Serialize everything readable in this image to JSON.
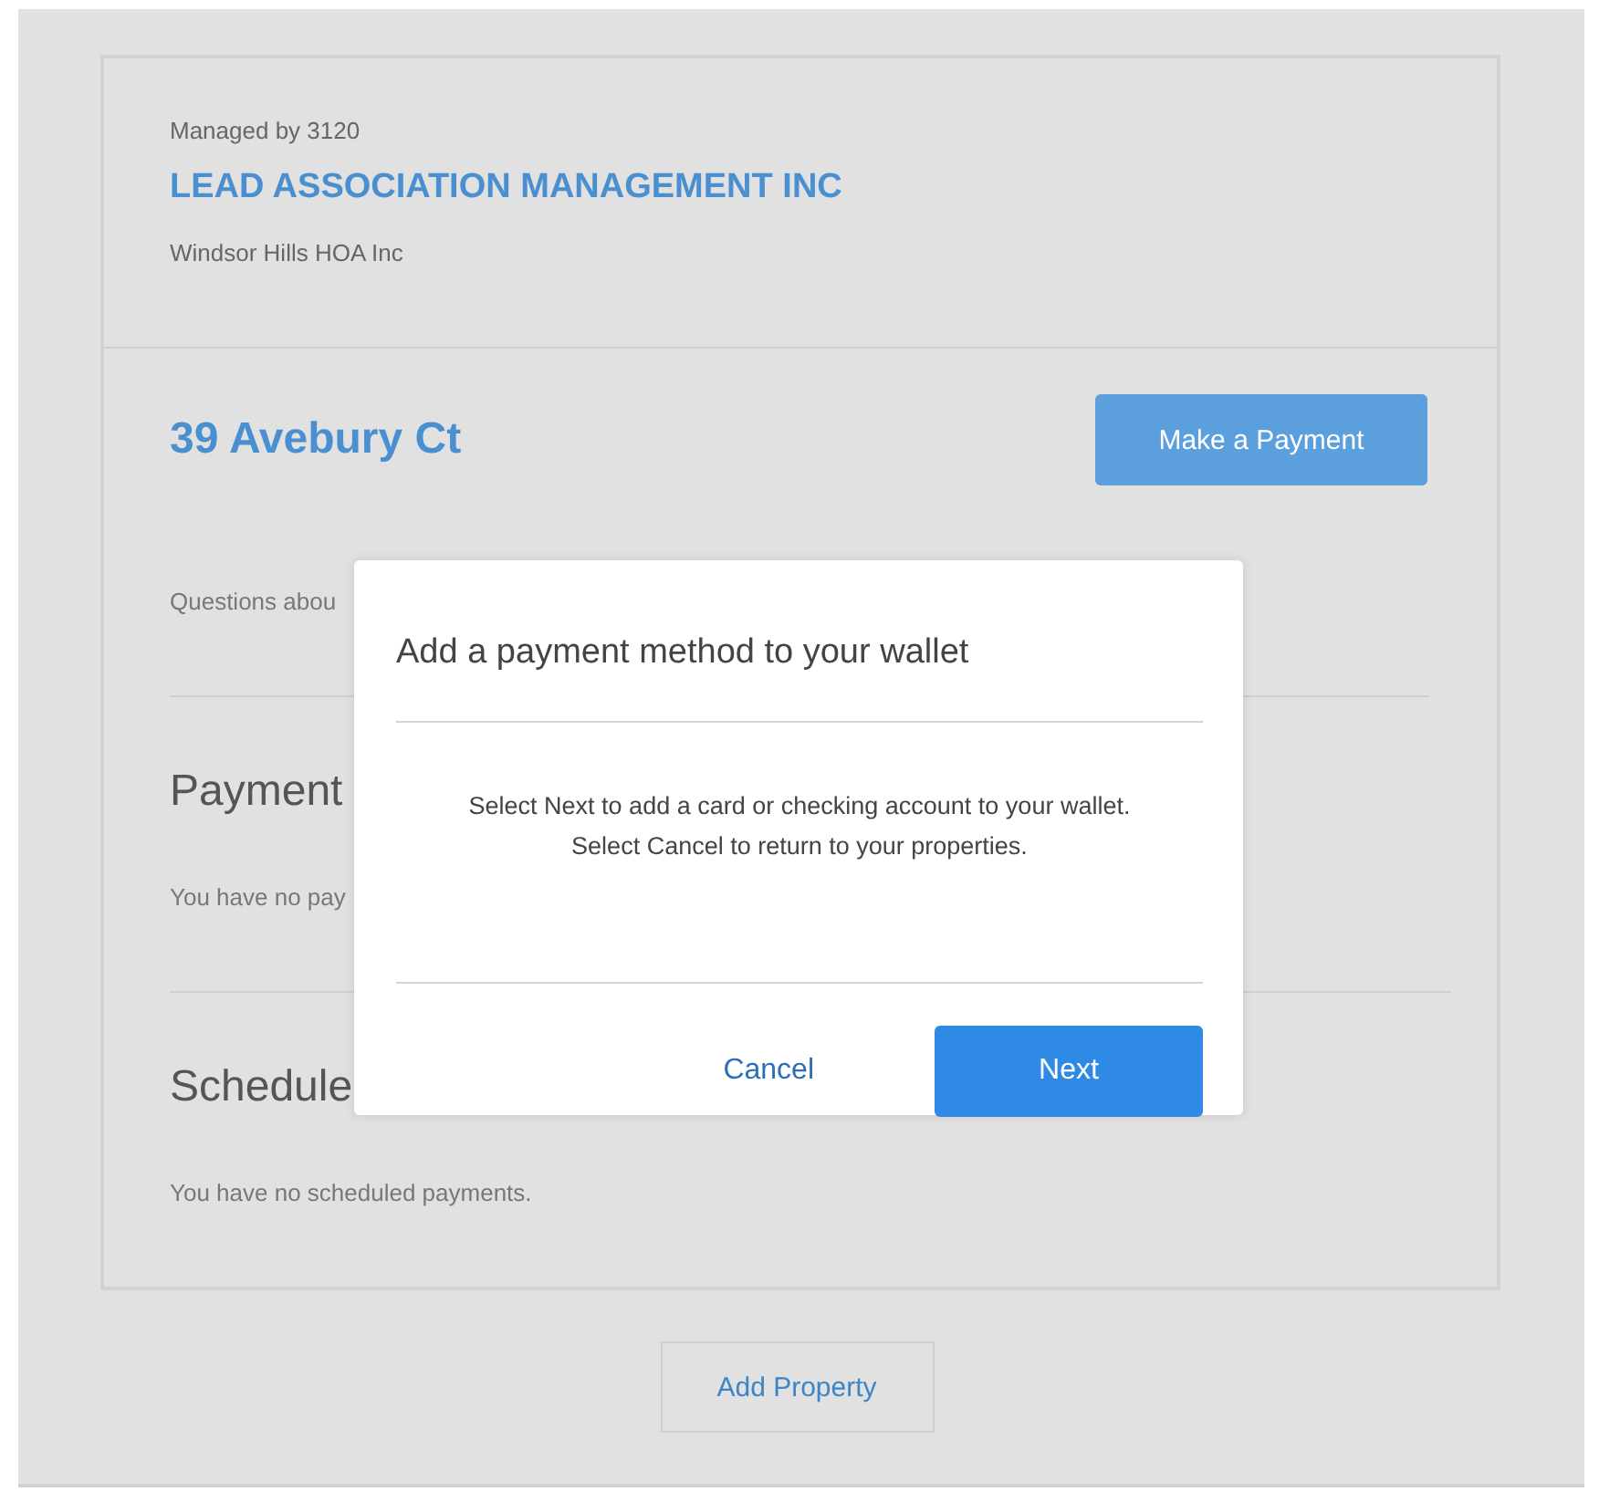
{
  "card": {
    "managed_by": "Managed by 3120",
    "company": "LEAD ASSOCIATION MANAGEMENT INC",
    "association": "Windsor Hills HOA Inc",
    "address": "39 Avebury Ct",
    "make_payment_button": "Make a Payment",
    "questions_text": "Questions abou",
    "payments_heading": "Payment",
    "payments_empty": "You have no pay",
    "scheduled_heading": "Schedule",
    "scheduled_empty": "You have no scheduled payments."
  },
  "add_property_button": "Add Property",
  "dialog": {
    "title": "Add a payment method to your wallet",
    "message_lines": [
      "Select Next to add a card or checking account to your wallet.",
      "Select Cancel to return to your properties."
    ],
    "cancel_button": "Cancel",
    "next_button": "Next"
  }
}
